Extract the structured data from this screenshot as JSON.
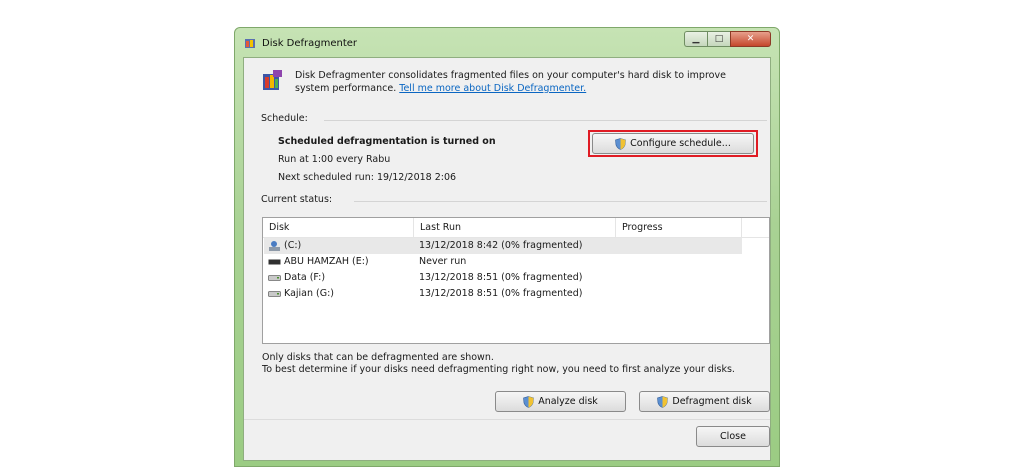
{
  "window": {
    "title": "Disk Defragmenter",
    "icon": "defrag-app-icon"
  },
  "caption_buttons": {
    "minimize": "minimize-icon",
    "maximize": "maximize-icon",
    "close": "close-icon"
  },
  "intro": {
    "text": "Disk Defragmenter consolidates fragmented files on your computer's hard disk to improve system performance.",
    "link": "Tell me more about Disk Defragmenter."
  },
  "schedule": {
    "label": "Schedule:",
    "status": "Scheduled defragmentation is turned on",
    "run_at": "Run at 1:00 every Rabu",
    "next_run": "Next scheduled run: 19/12/2018 2:06",
    "configure_button": "Configure schedule..."
  },
  "current_status": {
    "label": "Current status:",
    "columns": [
      "Disk",
      "Last Run",
      "Progress"
    ],
    "rows": [
      {
        "disk": "(C:)",
        "icon": "system-drive-icon",
        "last_run": "13/12/2018 8:42 (0% fragmented)",
        "progress": "",
        "selected": true
      },
      {
        "disk": "ABU HAMZAH (E:)",
        "icon": "removable-drive-icon",
        "last_run": "Never run",
        "progress": ""
      },
      {
        "disk": "Data (F:)",
        "icon": "hard-drive-icon",
        "last_run": "13/12/2018 8:51 (0% fragmented)",
        "progress": ""
      },
      {
        "disk": "Kajian (G:)",
        "icon": "hard-drive-icon",
        "last_run": "13/12/2018 8:51 (0% fragmented)",
        "progress": ""
      }
    ]
  },
  "notes": {
    "line1": "Only disks that can be defragmented are shown.",
    "line2": "To best determine if your disks need defragmenting right now, you need to first analyze your disks."
  },
  "buttons": {
    "analyze": "Analyze disk",
    "defragment": "Defragment disk",
    "close": "Close"
  },
  "colors": {
    "frame": "#a9d294",
    "link": "#0a66c2",
    "highlight": "#e01b24"
  }
}
